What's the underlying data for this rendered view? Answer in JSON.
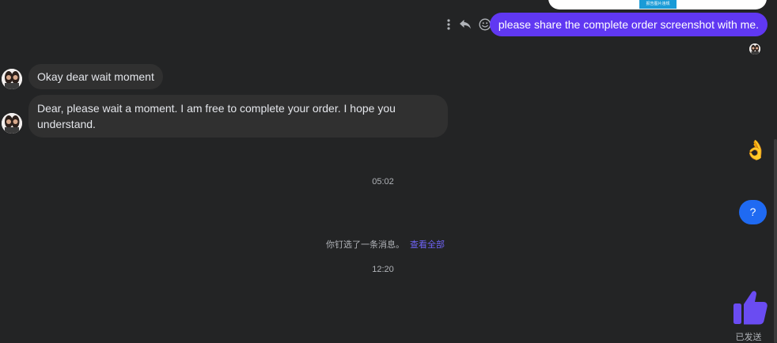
{
  "top_card": {
    "button_label": "报告图片违规"
  },
  "outgoing_message": {
    "text": "please share the complete order screenshot with me."
  },
  "incoming_messages": [
    {
      "text": "Okay dear wait moment"
    },
    {
      "text": "Dear, please wait a moment. I am free to complete your order. I hope you understand."
    }
  ],
  "timestamps": [
    "05:02",
    "12:20"
  ],
  "pinned_notice": {
    "text": "你钉选了一条消息。",
    "link": "查看全部"
  },
  "emoji_message": {
    "glyph": "👌"
  },
  "question_message": {
    "text": "?"
  },
  "send_status": "已发送",
  "icons": {
    "more": "more-vertical-icon",
    "reply": "reply-icon",
    "react": "smiley-icon",
    "like": "thumbs-up-icon"
  },
  "colors": {
    "outgoing_bubble": "#6038f2",
    "question_bubble": "#1f6af2",
    "incoming_bubble": "#303030",
    "accent_link": "#6f63f5",
    "background": "#232425"
  }
}
